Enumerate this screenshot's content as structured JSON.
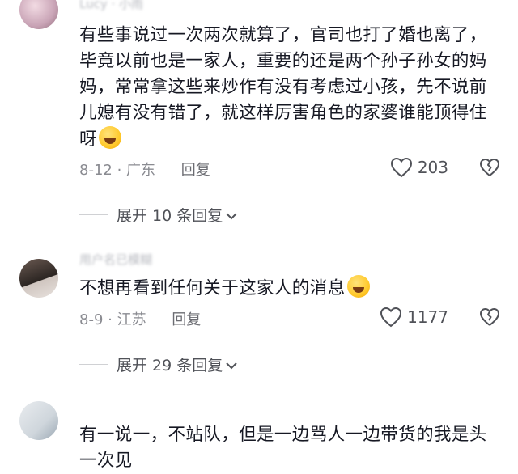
{
  "comments": [
    {
      "username": "Lucy · 小雨",
      "text": "有些事说过一次两次就算了，官司也打了婚也离了，毕竟以前也是一家人，重要的还是两个孙子孙女的妈妈，常常拿这些来炒作有没有考虑过小孩，先不说前儿媳有没有错了，就这样厉害角色的家婆谁能顶得住呀",
      "date": "8-12",
      "location": "广东",
      "reply_label": "回复",
      "likes": "203",
      "expand_label": "展开 10 条回复"
    },
    {
      "username": "用户名已模糊",
      "text": "不想再看到任何关于这家人的消息",
      "date": "8-9",
      "location": "江苏",
      "reply_label": "回复",
      "likes": "1177",
      "expand_label": "展开 29 条回复"
    },
    {
      "username": "",
      "text": "有一说一，不站队，但是一边骂人一边带货的我是头一次见"
    }
  ],
  "icons": {
    "like": "heart-outline-icon",
    "dislike": "broken-heart-icon",
    "expand": "chevron-down-icon",
    "emoji1": "rofl-emoji",
    "emoji2": "grinning-sweat-emoji"
  }
}
